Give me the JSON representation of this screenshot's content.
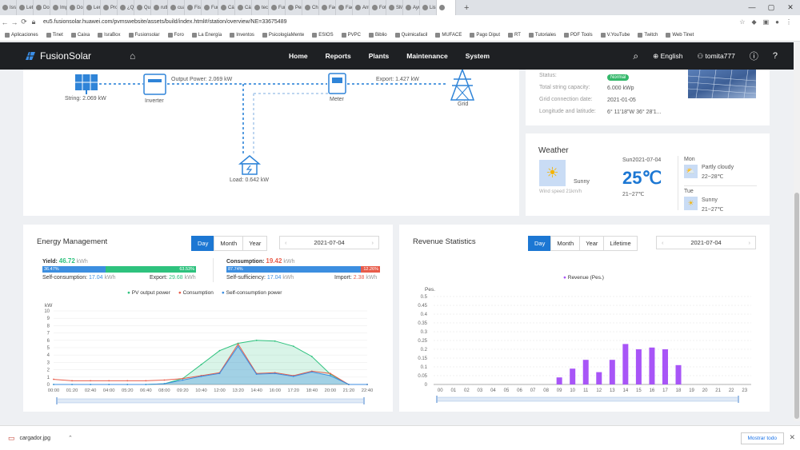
{
  "browser": {
    "tabs": [
      "Isra",
      "Let",
      "Dor",
      "Imp",
      "Dor",
      "Len",
      "Pro",
      "¿Qu",
      "Qui",
      "ruth",
      "cua:",
      "Fisi",
      "Fun",
      "Cál:",
      "Cál:",
      "tecr",
      "Fun",
      "Pen:",
      "Chil",
      "Fac",
      "Fac",
      "Ant",
      "Foti",
      "SM",
      "Ayu",
      "List",
      ""
    ],
    "url": "eu5.fusionsolar.huawei.com/pvmswebsite/assets/build/index.html#/station/overview/NE=33675489",
    "bookmarks": [
      "Aplicaciones",
      "Tinet",
      "Caixa",
      "IsraBox",
      "Fusionsolar",
      "Foro",
      "La Energía",
      "Inventos",
      "PsicologíaMente",
      "ESIOS",
      "PVPC",
      "Biblio",
      "Quimicafacil",
      "MUFACE",
      "Pago Diput",
      "RT",
      "Tutoriales",
      "PDF Tools",
      "V.YouTube",
      "Twitch",
      "Web Tinet"
    ]
  },
  "nav": {
    "brand": "FusionSolar",
    "menu": [
      "Home",
      "Reports",
      "Plants",
      "Maintenance",
      "System"
    ],
    "language": "English",
    "user": "tomita777"
  },
  "flow": {
    "string_label": "String: 2.069 kW",
    "inverter_label": "Inverter",
    "output_power": "Output Power: 2.069 kW",
    "meter_label": "Meter",
    "export_label": "Export: 1.427 kW",
    "grid_label": "Grid",
    "load_label": "Load: 0.642 kW"
  },
  "plant_info": {
    "status_label": "Status:",
    "status_value": "Normal",
    "capacity_label": "Total string capacity:",
    "capacity_value": "6.000 kWp",
    "grid_date_label": "Grid connection date:",
    "grid_date_value": "2021-01-05",
    "lonlat_label": "Longitude and latitude:",
    "lonlat_value": "6° 11'18\"W   36° 28'1..."
  },
  "weather": {
    "title": "Weather",
    "condition": "Sunny",
    "wind": "Wind speed 21km/h",
    "date": "Sun2021-07-04",
    "temp": "25℃",
    "range": "21~27℃",
    "forecast": [
      {
        "day": "Mon",
        "condition": "Partly cloudy",
        "range": "22~28℃"
      },
      {
        "day": "Tue",
        "condition": "Sunny",
        "range": "21~27℃"
      }
    ]
  },
  "energy": {
    "title": "Energy Management",
    "tabs": [
      "Day",
      "Month",
      "Year"
    ],
    "date": "2021-07-04",
    "yield_label": "Yield:",
    "yield_value": "46.72",
    "yield_unit": "kWh",
    "self_pct": "36.47%",
    "export_pct": "63.53%",
    "self_consumption_label": "Self-consumption:",
    "self_consumption_value": "17.04",
    "export_label": "Export:",
    "export_value": "29.68",
    "unit": "kWh",
    "consumption_label": "Consumption:",
    "consumption_value": "19.42",
    "suff_pct": "87.74%",
    "import_pct": "12.26%",
    "sufficiency_label": "Self-sufficiency:",
    "sufficiency_value": "17.04",
    "import_label": "Import:",
    "import_value": "2.38",
    "legend": [
      "PV output power",
      "Consumption",
      "Self-consumption power"
    ],
    "axis_unit": "kW"
  },
  "revenue": {
    "title": "Revenue Statistics",
    "tabs": [
      "Day",
      "Month",
      "Year",
      "Lifetime"
    ],
    "date": "2021-07-04",
    "legend": "Revenue (Pes.)",
    "axis_unit": "Pes."
  },
  "chart_data": [
    {
      "type": "line",
      "title": "Energy Management",
      "ylabel": "kW",
      "ylim": [
        0,
        10
      ],
      "yticks": [
        0,
        1,
        2,
        3,
        4,
        5,
        6,
        7,
        8,
        9,
        10
      ],
      "x": [
        "00:00",
        "01:20",
        "02:40",
        "04:00",
        "05:20",
        "06:40",
        "08:00",
        "09:20",
        "10:40",
        "12:00",
        "13:20",
        "14:40",
        "16:00",
        "17:20",
        "18:40",
        "20:00",
        "21:20",
        "22:40"
      ],
      "series": [
        {
          "name": "PV output power",
          "color": "#2ec27e",
          "values": [
            0,
            0,
            0,
            0,
            0,
            0,
            0.1,
            0.8,
            2.7,
            4.6,
            5.6,
            6.0,
            5.9,
            5.2,
            3.8,
            1.4,
            0,
            0
          ]
        },
        {
          "name": "Consumption",
          "color": "#e85c4a",
          "values": [
            0.7,
            0.5,
            0.5,
            0.5,
            0.5,
            0.5,
            0.6,
            0.8,
            1.2,
            1.6,
            5.5,
            1.5,
            1.6,
            1.2,
            1.8,
            1.5,
            0,
            0
          ]
        },
        {
          "name": "Self-consumption power",
          "color": "#3c8ee0",
          "values": [
            0,
            0,
            0,
            0,
            0,
            0,
            0.1,
            0.6,
            1.1,
            1.5,
            5.2,
            1.4,
            1.5,
            1.1,
            1.7,
            1.2,
            0,
            0
          ]
        }
      ]
    },
    {
      "type": "bar",
      "title": "Revenue Statistics",
      "ylabel": "Pes.",
      "ylim": [
        0,
        0.5
      ],
      "yticks": [
        0,
        0.05,
        0.1,
        0.15,
        0.2,
        0.25,
        0.3,
        0.35,
        0.4,
        0.45,
        0.5
      ],
      "categories": [
        "00",
        "01",
        "02",
        "03",
        "04",
        "05",
        "06",
        "07",
        "08",
        "09",
        "10",
        "11",
        "12",
        "13",
        "14",
        "15",
        "16",
        "17",
        "18",
        "19",
        "20",
        "21",
        "22",
        "23"
      ],
      "series": [
        {
          "name": "Revenue (Pes.)",
          "color": "#a855f7",
          "values": [
            0,
            0,
            0,
            0,
            0,
            0,
            0,
            0,
            0,
            0.04,
            0.09,
            0.14,
            0.07,
            0.14,
            0.23,
            0.2,
            0.21,
            0.2,
            0.11,
            0,
            0,
            0,
            0,
            0
          ]
        }
      ]
    }
  ],
  "downloads": {
    "file": "cargador.jpg",
    "show_all": "Mostrar todo"
  }
}
